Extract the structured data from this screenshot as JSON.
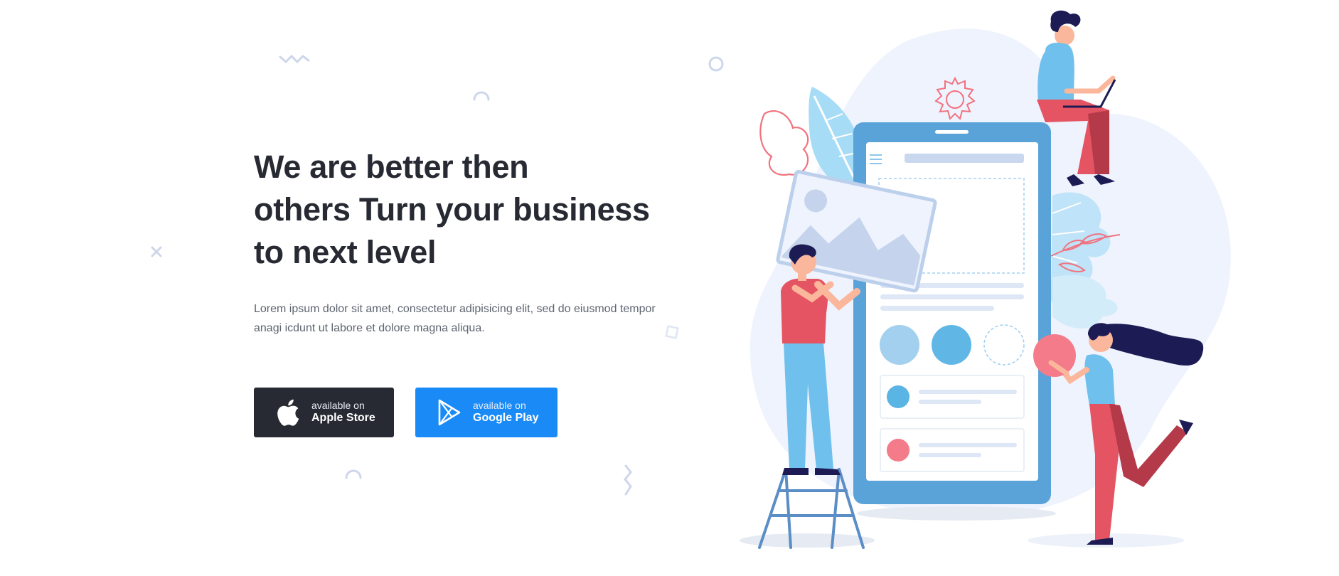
{
  "hero": {
    "title_lines": [
      "We are better then",
      "others Turn your business",
      "to next level"
    ],
    "description_lines": [
      "Lorem ipsum dolor sit amet, consectetur adipisicing elit, sed do eiusmod tempor",
      "anagi icdunt ut labore et dolore magna aliqua."
    ]
  },
  "store_buttons": [
    {
      "small": "available on",
      "big": "Apple Store",
      "icon": "apple-icon",
      "color": "#272a33"
    },
    {
      "small": "available on",
      "big": "Google Play",
      "icon": "google-play-icon",
      "color": "#1a8bf6"
    }
  ],
  "colors": {
    "heading": "#272a33",
    "body_text": "#5e6470",
    "accent_blue": "#1a8bf6",
    "dark": "#272a33",
    "phone_blue": "#5aa3d8",
    "pink": "#f2727f"
  }
}
